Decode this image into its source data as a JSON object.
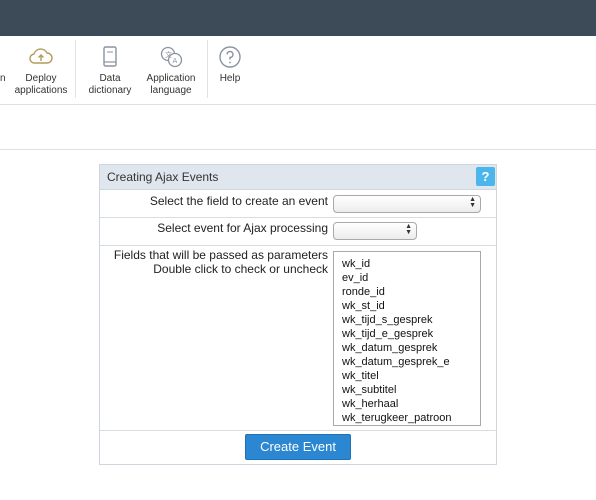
{
  "toolbar": {
    "partial_label": "n",
    "items": [
      {
        "id": "deploy",
        "label_line1": "Deploy",
        "label_line2": "applications",
        "icon": "cloud-upload-icon"
      },
      {
        "id": "data-dictionary",
        "label_line1": "Data",
        "label_line2": "dictionary",
        "icon": "book-icon"
      },
      {
        "id": "app-language",
        "label_line1": "Application",
        "label_line2": "language",
        "icon": "translate-icon"
      },
      {
        "id": "help",
        "label_line1": "Help",
        "label_line2": "",
        "icon": "question-circle-icon"
      }
    ]
  },
  "panel": {
    "title": "Creating Ajax Events",
    "help_label": "?",
    "field_label": "Select the field to create an event",
    "field_value": "",
    "event_label": "Select event for Ajax processing",
    "event_value": "",
    "params_label_line1": "Fields that will be passed as parameters",
    "params_label_line2": "Double click to check or uncheck",
    "params": [
      "wk_id",
      "ev_id",
      "ronde_id",
      "wk_st_id",
      "wk_tijd_s_gesprek",
      "wk_tijd_e_gesprek",
      "wk_datum_gesprek",
      "wk_datum_gesprek_e",
      "wk_titel",
      "wk_subtitel",
      "wk_herhaal",
      "wk_terugkeer_patroon"
    ],
    "create_button": "Create Event"
  },
  "colors": {
    "topbar": "#3d4b59",
    "panel_header": "#dfe6ee",
    "primary_button": "#2b87d1",
    "help_button": "#4bb6ec"
  }
}
